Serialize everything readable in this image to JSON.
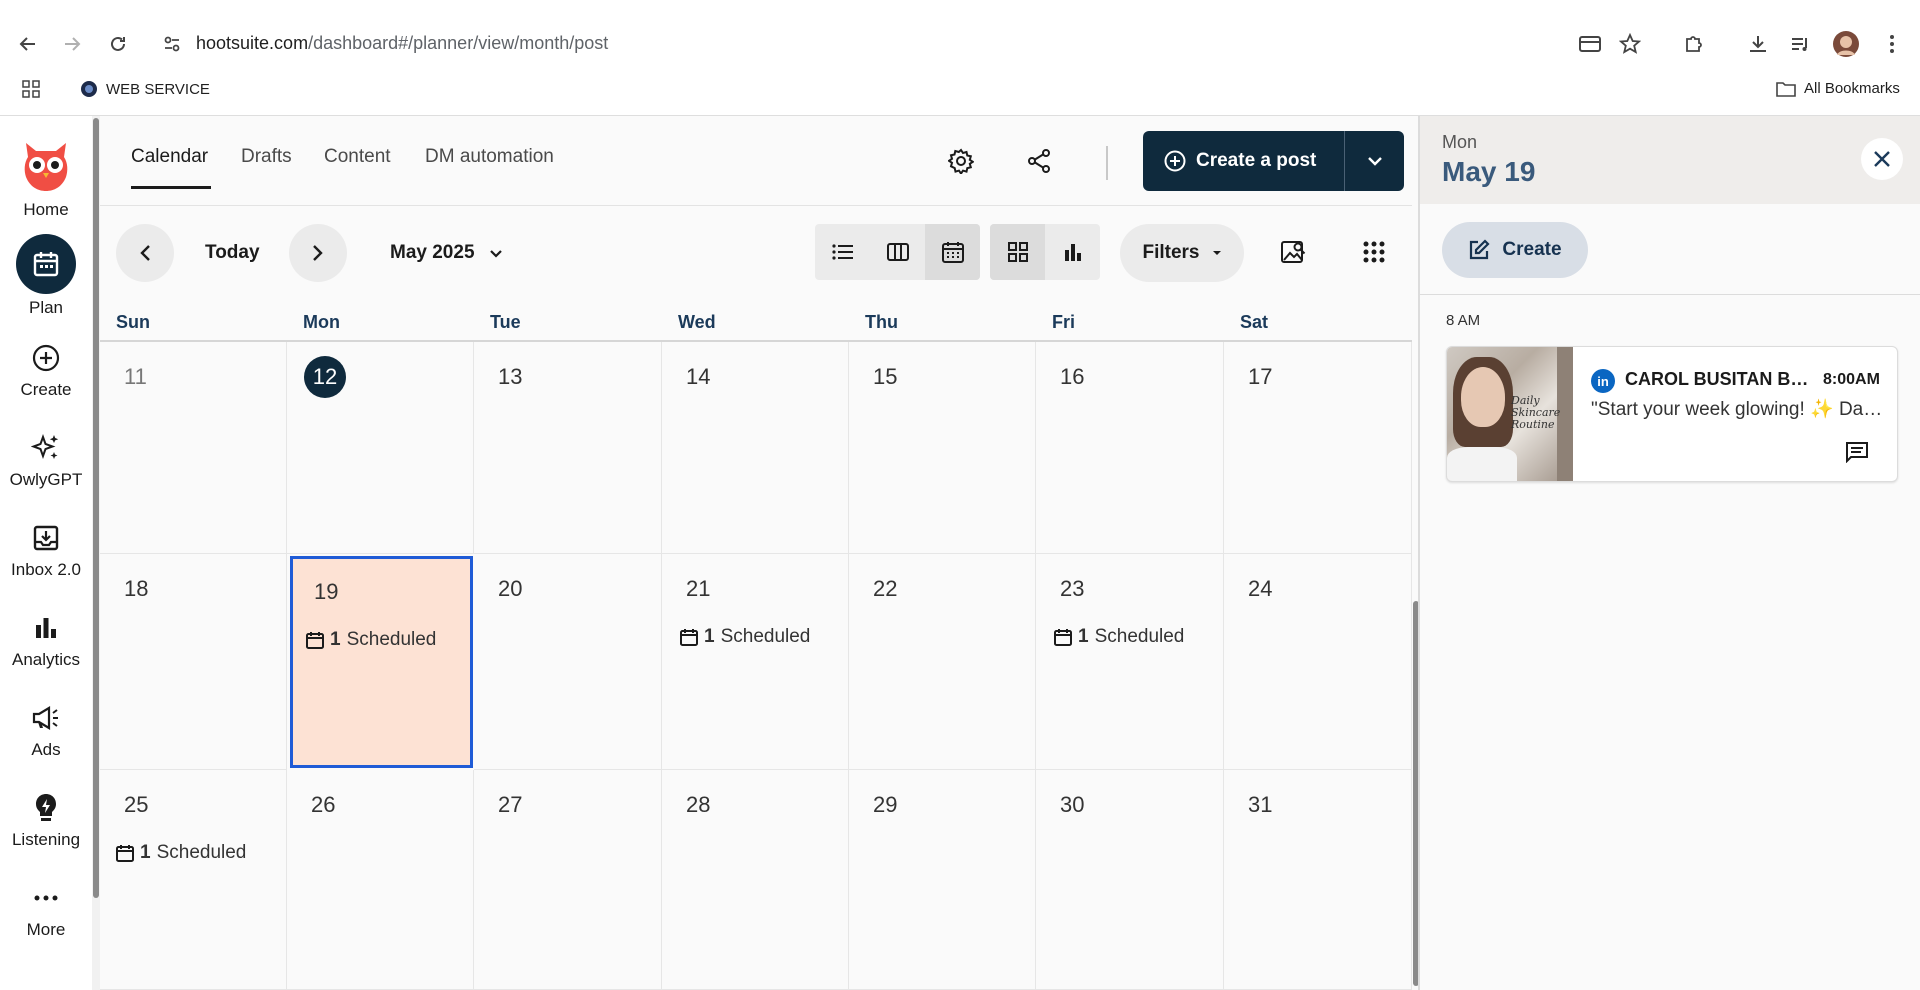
{
  "browser": {
    "url_host": "hootsuite.com",
    "url_path": "/dashboard#/planner/view/month/post",
    "bookmark_1": "WEB SERVICE",
    "bookmarks_all": "All Bookmarks"
  },
  "rail": {
    "home": "Home",
    "plan": "Plan",
    "create": "Create",
    "owlygpt": "OwlyGPT",
    "inbox": "Inbox 2.0",
    "analytics": "Analytics",
    "ads": "Ads",
    "listening": "Listening",
    "more": "More"
  },
  "tabs": [
    "Calendar",
    "Drafts",
    "Content",
    "DM automation"
  ],
  "create_post": "Create a post",
  "toolbar": {
    "today": "Today",
    "month": "May 2025",
    "filters": "Filters"
  },
  "days_of_week": [
    "Sun",
    "Mon",
    "Tue",
    "Wed",
    "Thu",
    "Fri",
    "Sat"
  ],
  "calendar": {
    "weeks": [
      [
        "11",
        "12",
        "13",
        "14",
        "15",
        "16",
        "17"
      ],
      [
        "18",
        "19",
        "20",
        "21",
        "22",
        "23",
        "24"
      ],
      [
        "25",
        "26",
        "27",
        "28",
        "29",
        "30",
        "31"
      ]
    ],
    "today": "12",
    "scheduled_count": "1",
    "scheduled_label": "Scheduled"
  },
  "panel": {
    "day": "Mon",
    "date": "May 19",
    "create": "Create",
    "time_slot": "8 AM",
    "post": {
      "network_badge": "in",
      "account": "CAROL BUSITAN BAUTISTA",
      "time": "8:00AM",
      "text": "\"Start your week glowing! ✨ Daily skincare routine\"",
      "image_text_1": "Daily",
      "image_text_2": "Skincare",
      "image_text_3": "Routine"
    }
  },
  "colors": {
    "brand_dark": "#0f2a3d",
    "selected_cell": "#fde2d4",
    "selected_border": "#1f5bd6",
    "linkedin": "#0a66c2"
  }
}
